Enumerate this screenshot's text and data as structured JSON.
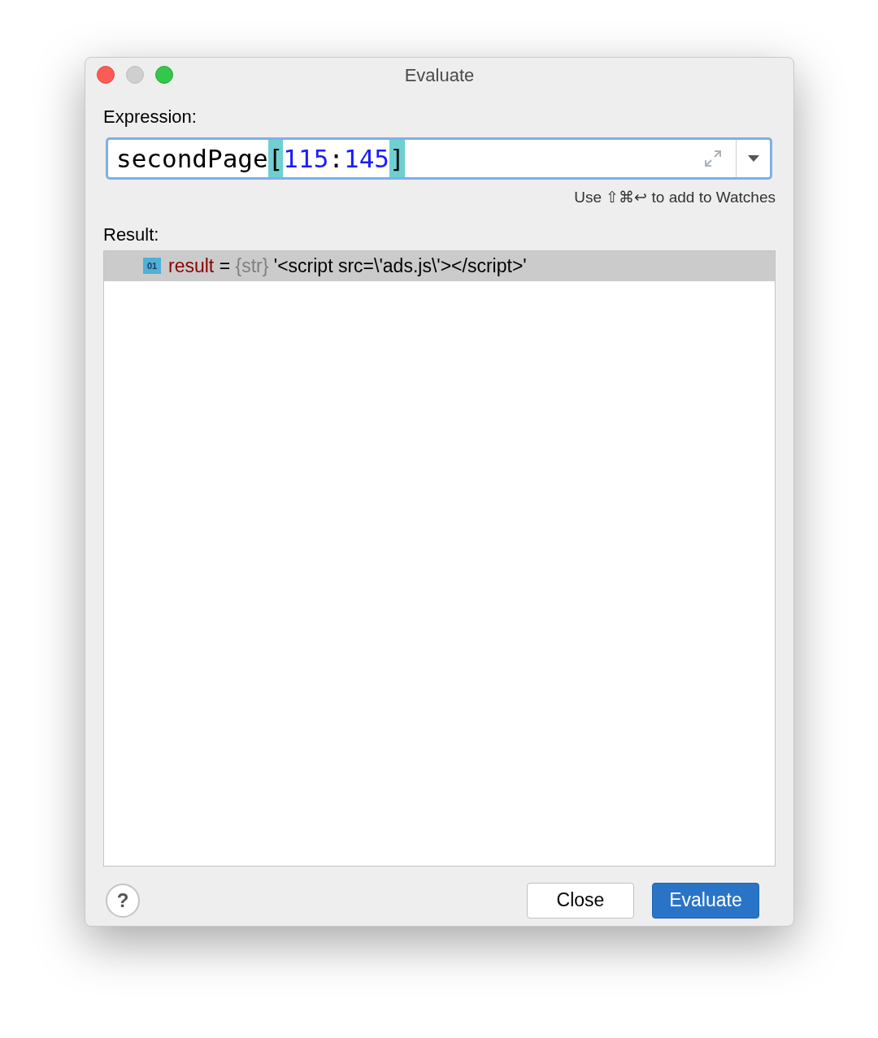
{
  "window": {
    "title": "Evaluate"
  },
  "expression": {
    "label": "Expression:",
    "tokens": [
      {
        "kind": "plain",
        "text": "secondPage"
      },
      {
        "kind": "bracket",
        "text": "["
      },
      {
        "kind": "number",
        "text": "115"
      },
      {
        "kind": "plain",
        "text": ":"
      },
      {
        "kind": "number",
        "text": "145"
      },
      {
        "kind": "bracket",
        "text": "]"
      }
    ],
    "hint": "Use ⇧⌘↩ to add to Watches"
  },
  "result": {
    "label": "Result:",
    "rows": [
      {
        "selected": true,
        "badge": "01",
        "parts": [
          {
            "kind": "name",
            "text": "result"
          },
          {
            "kind": "plain",
            "text": " = "
          },
          {
            "kind": "type",
            "text": "{str}"
          },
          {
            "kind": "plain",
            "text": " '<script src=\\'ads.js\\'></script>'"
          }
        ]
      }
    ]
  },
  "help": "?",
  "buttons": [
    {
      "label": "Close",
      "kind": "secondary"
    },
    {
      "label": "Evaluate",
      "kind": "primary"
    }
  ]
}
